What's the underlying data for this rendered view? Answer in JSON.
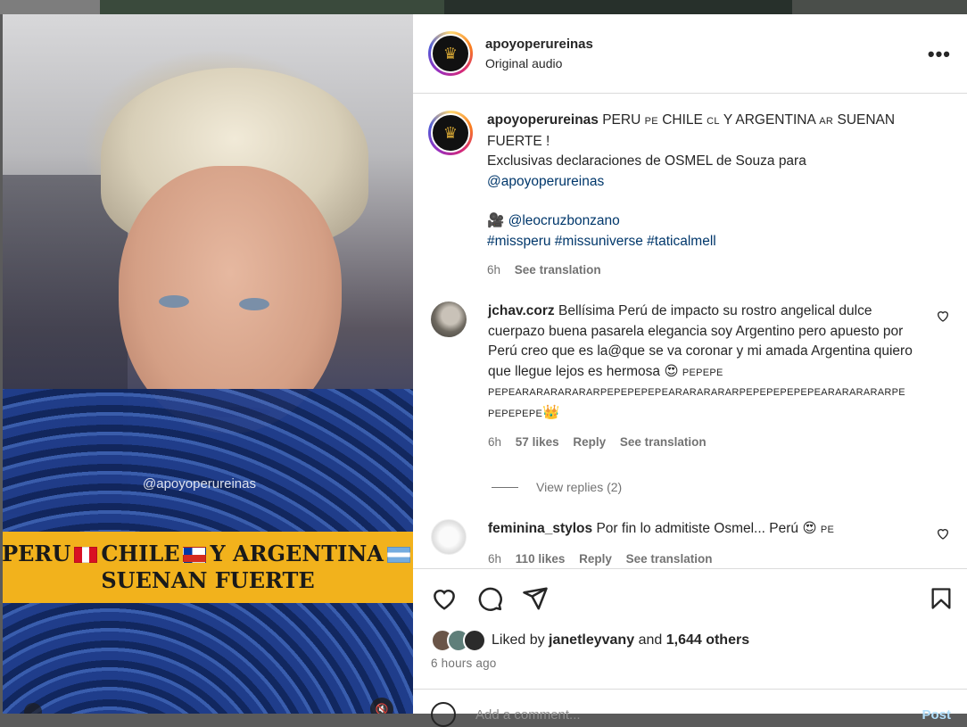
{
  "post": {
    "username": "apoyoperureinas",
    "audio": "Original audio",
    "avatar_icon": "crown-icon",
    "more_icon": "more-options-icon"
  },
  "media": {
    "watermark": "@apoyoperureinas",
    "banner_line1_a": "PERU",
    "banner_line1_b": "CHILE",
    "banner_line1_c": "Y ARGENTINA",
    "banner_line2": "SUENAN FUERTE",
    "banner_color": "#f2b21c"
  },
  "caption": {
    "username": "apoyoperureinas",
    "text1": "PERU",
    "code1": "PE",
    "text2": "CHILE",
    "code2": "CL",
    "text3": "Y ARGENTINA",
    "code3": "AR",
    "text4": "SUENAN FUERTE !",
    "line2": "Exclusivas declaraciones de OSMEL de Souza para",
    "mention1": "@apoyoperureinas",
    "camera_emoji": "🎥",
    "mention2": "@leocruzbonzano",
    "hashtags": "#missperu #missuniverse #taticalmell",
    "time": "6h",
    "see_translation": "See translation"
  },
  "comments": [
    {
      "username": "jchav.corz",
      "text": "Bellísima Perú de impacto su rostro angelical dulce cuerpazo buena pasarela elegancia soy Argentino pero apuesto por Perú creo que es la@que se va coronar y mi amada Argentina quiero que llegue lejos es hermosa",
      "emoji1": "😍",
      "flags_line1": "PEPEPE",
      "flags_line2": "PEPEARARARARARARPEPEPEPEPEARARARARARPEPEPEPEPEPEARARARARARPE",
      "flags_line3": "PEPEPEPE",
      "emoji2": "👑",
      "time": "6h",
      "likes": "57 likes",
      "reply": "Reply",
      "see_translation": "See translation",
      "view_replies": "View replies (2)"
    },
    {
      "username": "feminina_stylos",
      "text": "Por fin lo admitiste Osmel... Perú",
      "emoji1": "😍",
      "flag": "PE",
      "time": "6h",
      "likes": "110 likes",
      "reply": "Reply",
      "see_translation": "See translation"
    }
  ],
  "actions": {
    "like_icon": "heart-icon",
    "comment_icon": "comment-icon",
    "share_icon": "share-icon",
    "save_icon": "bookmark-icon",
    "liked_by_prefix": "Liked by",
    "liked_by_user": "janetleyvany",
    "liked_by_and": "and",
    "liked_by_others": "1,644 others",
    "time_ago": "6 hours ago"
  },
  "add_comment": {
    "placeholder": "Add a comment...",
    "post_label": "Post"
  }
}
